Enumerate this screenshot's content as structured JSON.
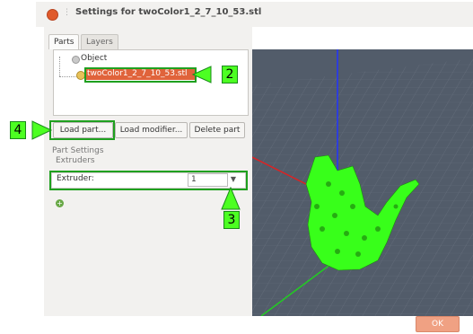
{
  "window": {
    "title": "Settings for twoColor1_2_7_10_53.stl"
  },
  "tabs": [
    {
      "label": "Parts"
    },
    {
      "label": "Layers"
    }
  ],
  "tree": {
    "root_label": "Object",
    "part_label": "twoColor1_2_7_10_53.stl"
  },
  "buttons": {
    "load_part": "Load part...",
    "load_modifier": "Load modifier...",
    "delete_part": "Delete part"
  },
  "part_settings": {
    "heading": "Part Settings",
    "group": "Extruders",
    "extruder_label": "Extruder:",
    "extruder_value": "1"
  },
  "callouts": [
    "2",
    "3",
    "4"
  ],
  "footer": {
    "ok_label": "OK"
  },
  "colors": {
    "selection": "#e0633b",
    "callout": "#4cff22",
    "model": "#38ff1a",
    "ok_button": "#f0a183"
  }
}
